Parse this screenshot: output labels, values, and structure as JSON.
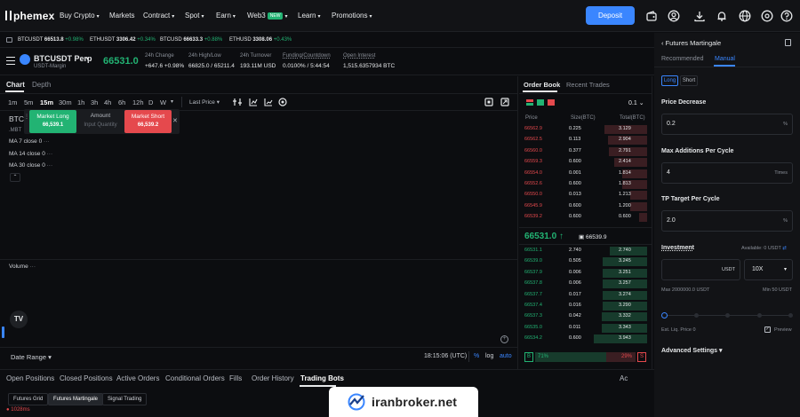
{
  "nav": {
    "logo": "phemex",
    "items": [
      {
        "label": "Buy Crypto",
        "dropdown": true
      },
      {
        "label": "Markets",
        "dropdown": false
      },
      {
        "label": "Contract",
        "dropdown": true
      },
      {
        "label": "Spot",
        "dropdown": true
      },
      {
        "label": "Earn",
        "dropdown": true
      },
      {
        "label": "Web3",
        "dropdown": true,
        "badge": "NEW"
      },
      {
        "label": "Learn",
        "dropdown": true
      },
      {
        "label": "Promotions",
        "dropdown": true
      }
    ],
    "deposit_label": "Deposit",
    "icons": [
      "wallet-icon",
      "user-icon",
      "download-icon",
      "bell-icon",
      "globe-icon",
      "settings-icon",
      "help-icon"
    ]
  },
  "ticker": [
    {
      "symbol": "BTCUSDT",
      "price": "66513.8",
      "change": "+0.98%"
    },
    {
      "symbol": "ETHUSDT",
      "price": "3306.42",
      "change": "+0.34%"
    },
    {
      "symbol": "BTCUSD",
      "price": "66633.3",
      "change": "+0.88%"
    },
    {
      "symbol": "ETHUSD",
      "price": "3308.06",
      "change": "+0.43%"
    }
  ],
  "symbol": {
    "name": "BTCUSDT Perp",
    "margin": "USDT-Margin",
    "last_price": "66531.0",
    "stats": [
      {
        "label": "24h Change",
        "value": "+647.6 +0.98%",
        "color": "#22b373"
      },
      {
        "label": "24h High/Low",
        "value": "66825.0 / 65211.4",
        "color": "#e6e8ea"
      },
      {
        "label": "24h Turnover",
        "value": "193.11M USD",
        "color": "#e6e8ea"
      },
      {
        "label": "Funding/Countdown",
        "value": "0.0100% / 5:44:54",
        "color": "#e6e8ea"
      },
      {
        "label": "Open Interest",
        "value": "1,515.6357934 BTC",
        "color": "#e6e8ea"
      }
    ]
  },
  "chart": {
    "tabs": [
      "Chart",
      "Depth"
    ],
    "active_tab": "Chart",
    "timeframes": [
      "1m",
      "5m",
      "15m",
      "30m",
      "1h",
      "3h",
      "4h",
      "6h",
      "12h",
      "D",
      "W"
    ],
    "active_timeframe": "15m",
    "price_type": "Last Price",
    "symbol_short": "BTC",
    "symbol_sub": ".MBT",
    "ma_lines": [
      "MA 7 close 0",
      "MA 14 close 0",
      "MA 30 close 0"
    ],
    "quick_trade": {
      "long_label": "Market Long",
      "long_price": "66,539.1",
      "amount_label": "Amount",
      "amount_placeholder": "Input Quantity",
      "short_label": "Market Short",
      "short_price": "66,539.2"
    },
    "volume_label": "Volume",
    "date_range_label": "Date Range",
    "clock": "18:15:06 (UTC)",
    "scale_pct": "%",
    "scale_log": "log",
    "scale_auto": "auto"
  },
  "orderbook": {
    "tabs": [
      "Order Book",
      "Recent Trades"
    ],
    "active_tab": "Order Book",
    "precision": "0.1",
    "headers": [
      "Price",
      "Size(BTC)",
      "Total(BTC)"
    ],
    "asks": [
      {
        "price": "66562.9",
        "size": "0.225",
        "total": "3.129",
        "depth": 0.8
      },
      {
        "price": "66562.5",
        "size": "0.113",
        "total": "2.904",
        "depth": 0.74
      },
      {
        "price": "66560.0",
        "size": "0.377",
        "total": "2.791",
        "depth": 0.71
      },
      {
        "price": "66559.3",
        "size": "0.600",
        "total": "2.414",
        "depth": 0.62
      },
      {
        "price": "66554.0",
        "size": "0.001",
        "total": "1.814",
        "depth": 0.46
      },
      {
        "price": "66552.6",
        "size": "0.600",
        "total": "1.813",
        "depth": 0.46
      },
      {
        "price": "66550.0",
        "size": "0.013",
        "total": "1.213",
        "depth": 0.31
      },
      {
        "price": "66545.9",
        "size": "0.600",
        "total": "1.200",
        "depth": 0.31
      },
      {
        "price": "66539.2",
        "size": "0.600",
        "total": "0.600",
        "depth": 0.15
      }
    ],
    "last_price": "66531.0",
    "mark_price": "66539.9",
    "bids": [
      {
        "price": "66531.1",
        "size": "2.740",
        "total": "2.740",
        "depth": 0.7
      },
      {
        "price": "66539.0",
        "size": "0.505",
        "total": "3.245",
        "depth": 0.83
      },
      {
        "price": "66537.9",
        "size": "0.006",
        "total": "3.251",
        "depth": 0.83
      },
      {
        "price": "66537.8",
        "size": "0.006",
        "total": "3.257",
        "depth": 0.83
      },
      {
        "price": "66537.7",
        "size": "0.017",
        "total": "3.274",
        "depth": 0.84
      },
      {
        "price": "66537.4",
        "size": "0.016",
        "total": "3.290",
        "depth": 0.84
      },
      {
        "price": "66537.3",
        "size": "0.042",
        "total": "3.332",
        "depth": 0.85
      },
      {
        "price": "66535.0",
        "size": "0.011",
        "total": "3.343",
        "depth": 0.85
      },
      {
        "price": "66534.2",
        "size": "0.600",
        "total": "3.943",
        "depth": 1.0
      }
    ],
    "buy_pct_label": "71%",
    "sell_pct_label": "29%",
    "buy_ratio": 0.71
  },
  "martingale": {
    "title": "Futures Martingale",
    "tabs": [
      "Recommended",
      "Manual"
    ],
    "active_tab": "Manual",
    "directions": [
      "Long",
      "Short"
    ],
    "active_direction": "Long",
    "price_decrease": {
      "label": "Price Decrease",
      "value": "0.2",
      "unit": "%"
    },
    "max_additions": {
      "label": "Max Additions Per Cycle",
      "value": "4",
      "unit": "Times"
    },
    "tp_target": {
      "label": "TP Target Per Cycle",
      "value": "2.0",
      "unit": "%"
    },
    "investment": {
      "label": "Investment",
      "available": "Available: 0 USDT",
      "unit": "USDT",
      "leverage": "10X",
      "max": "Max 2000000.0 USDT",
      "min": "Min 50 USDT"
    },
    "slider_ratio": 0.0,
    "liq_price": "Est. Liq. Price 0",
    "preview_label": "Preview",
    "advanced_label": "Advanced Settings"
  },
  "bottom": {
    "tabs": [
      "Open Positions",
      "Closed Positions",
      "Active Orders",
      "Conditional Orders",
      "Fills",
      "Order History",
      "Trading Bots"
    ],
    "active_tab": "Trading Bots",
    "subtabs": [
      "Futures Grid",
      "Futures Martingale",
      "Signal Trading"
    ],
    "active_subtab": "Futures Martingale",
    "latency": "1028ms",
    "cut_label": "Ac"
  },
  "watermark": {
    "text": "iranbroker.net"
  },
  "colors": {
    "accent": "#3a86ff",
    "green": "#22b373",
    "red": "#e5494d",
    "bg": "#0c0d10",
    "panel": "#121316"
  }
}
